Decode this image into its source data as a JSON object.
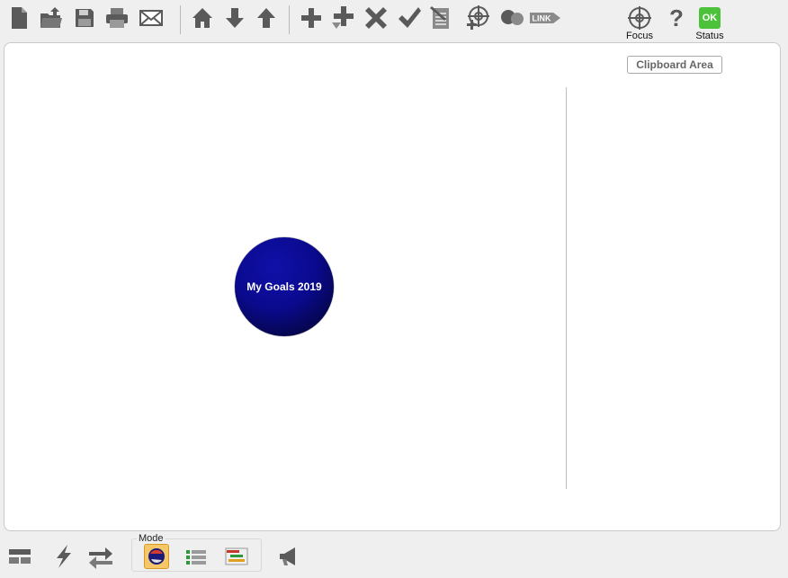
{
  "toolbar": {
    "buttons": [
      {
        "name": "new-document-icon"
      },
      {
        "name": "open-folder-icon"
      },
      {
        "name": "save-icon"
      },
      {
        "name": "print-icon"
      },
      {
        "name": "email-icon"
      },
      {
        "name": "home-icon"
      },
      {
        "name": "arrow-down-icon"
      },
      {
        "name": "arrow-up-icon"
      },
      {
        "name": "add-icon"
      },
      {
        "name": "add-child-icon"
      },
      {
        "name": "delete-icon"
      },
      {
        "name": "checkmark-icon"
      },
      {
        "name": "edit-notes-icon"
      },
      {
        "name": "target-add-icon"
      },
      {
        "name": "bubbles-icon"
      },
      {
        "name": "link-icon"
      }
    ],
    "link_label": "LINK",
    "focus_label": "Focus",
    "help_symbol": "?",
    "status_badge": "OK",
    "status_label": "Status"
  },
  "canvas": {
    "clipboard_button": "Clipboard Area",
    "goal_node": "My Goals 2019"
  },
  "bottombar": {
    "mode_label": "Mode",
    "mode_buttons": [
      "mode-mindmap-icon",
      "mode-list-icon",
      "mode-gantt-icon"
    ],
    "active_mode": "mode-mindmap-icon"
  },
  "colors": {
    "icon_gray": "#555555",
    "node_blue": "#0a0a8f",
    "status_green": "#4cc23a",
    "active_mode_bg": "#f6c768"
  }
}
